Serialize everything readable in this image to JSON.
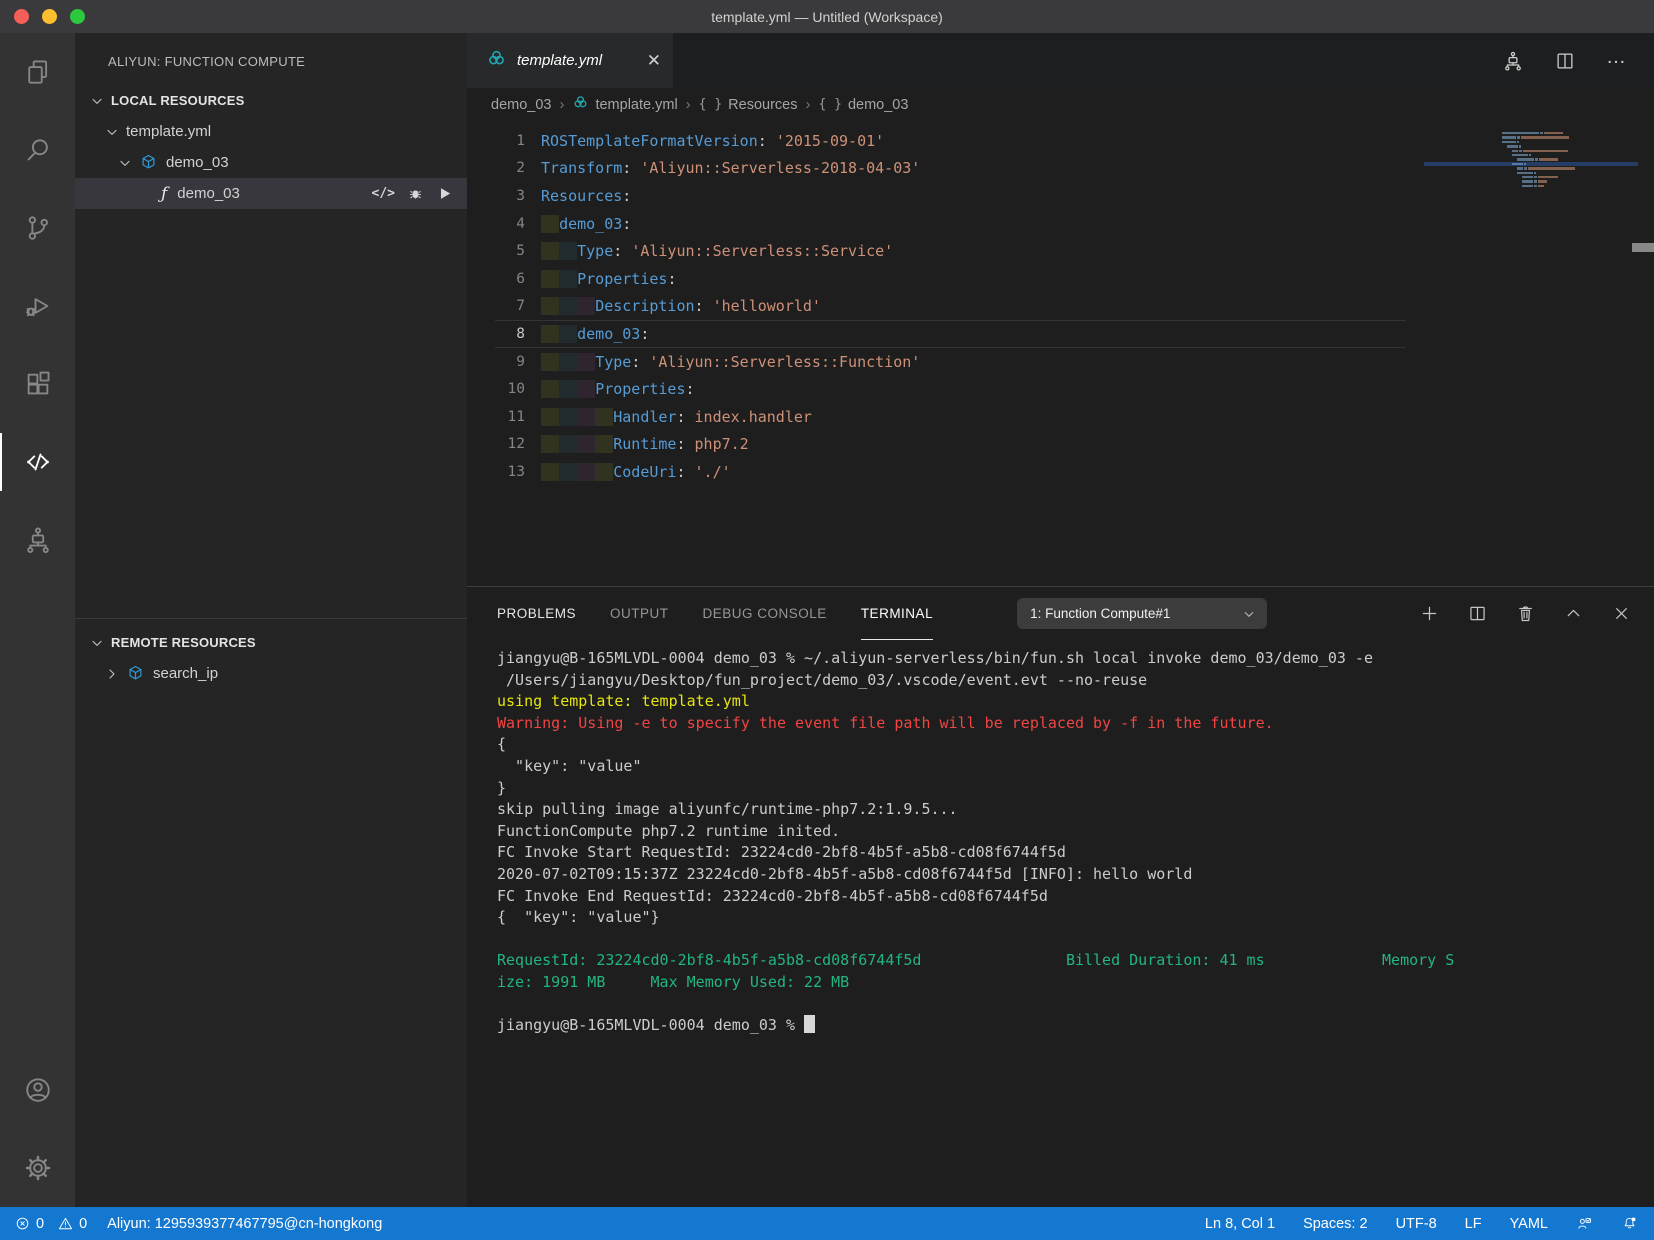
{
  "window": {
    "title": "template.yml — Untitled (Workspace)"
  },
  "colors": {
    "accent": "#1478d1",
    "aliyun_teal": "#1fa8b0",
    "cube_blue": "#2f9ad6",
    "key_blue": "#569cd6",
    "string_orange": "#ce9178",
    "terminal_green": "#23b57f",
    "terminal_yellow": "#e5e510",
    "terminal_red": "#ef4545"
  },
  "sidebar": {
    "title": "ALIYUN: FUNCTION COMPUTE",
    "sections": {
      "local": "LOCAL RESOURCES",
      "remote": "REMOTE RESOURCES"
    },
    "local_tree": {
      "file": "template.yml",
      "service": "demo_03",
      "function": "demo_03"
    },
    "remote_tree": {
      "service": "search_ip"
    }
  },
  "editor": {
    "tab": "template.yml",
    "breadcrumb": [
      "demo_03",
      "template.yml",
      "Resources",
      "demo_03"
    ],
    "code_lines": [
      {
        "n": 1,
        "g": 0,
        "tokens": [
          [
            "k",
            "ROSTemplateFormatVersion"
          ],
          [
            "p",
            ": "
          ],
          [
            "s",
            "'2015-09-01'"
          ]
        ]
      },
      {
        "n": 2,
        "g": 0,
        "tokens": [
          [
            "k",
            "Transform"
          ],
          [
            "p",
            ": "
          ],
          [
            "s",
            "'Aliyun::Serverless-2018-04-03'"
          ]
        ]
      },
      {
        "n": 3,
        "g": 0,
        "tokens": [
          [
            "k",
            "Resources"
          ],
          [
            "p",
            ":"
          ]
        ]
      },
      {
        "n": 4,
        "g": 1,
        "tokens": [
          [
            "k",
            "demo_03"
          ],
          [
            "p",
            ":"
          ]
        ]
      },
      {
        "n": 5,
        "g": 2,
        "tokens": [
          [
            "k",
            "Type"
          ],
          [
            "p",
            ": "
          ],
          [
            "s",
            "'Aliyun::Serverless::Service'"
          ]
        ]
      },
      {
        "n": 6,
        "g": 2,
        "tokens": [
          [
            "k",
            "Properties"
          ],
          [
            "p",
            ":"
          ]
        ]
      },
      {
        "n": 7,
        "g": 3,
        "tokens": [
          [
            "k",
            "Description"
          ],
          [
            "p",
            ": "
          ],
          [
            "s",
            "'helloworld'"
          ]
        ]
      },
      {
        "n": 8,
        "g": 2,
        "current": true,
        "tokens": [
          [
            "k",
            "demo_03"
          ],
          [
            "p",
            ":"
          ]
        ]
      },
      {
        "n": 9,
        "g": 3,
        "tokens": [
          [
            "k",
            "Type"
          ],
          [
            "p",
            ": "
          ],
          [
            "s",
            "'Aliyun::Serverless::Function'"
          ]
        ]
      },
      {
        "n": 10,
        "g": 3,
        "tokens": [
          [
            "k",
            "Properties"
          ],
          [
            "p",
            ":"
          ]
        ]
      },
      {
        "n": 11,
        "g": 4,
        "tokens": [
          [
            "k",
            "Handler"
          ],
          [
            "p",
            ": "
          ],
          [
            "s",
            "index.handler"
          ]
        ]
      },
      {
        "n": 12,
        "g": 4,
        "tokens": [
          [
            "k",
            "Runtime"
          ],
          [
            "p",
            ": "
          ],
          [
            "s",
            "php7.2"
          ]
        ]
      },
      {
        "n": 13,
        "g": 4,
        "tokens": [
          [
            "k",
            "CodeUri"
          ],
          [
            "p",
            ": "
          ],
          [
            "s",
            "'./'"
          ]
        ]
      }
    ]
  },
  "panel": {
    "tabs": [
      "PROBLEMS",
      "OUTPUT",
      "DEBUG CONSOLE",
      "TERMINAL"
    ],
    "active_tab": "TERMINAL",
    "terminal_dropdown": "1: Function Compute#1",
    "terminal_lines": [
      {
        "c": "d",
        "t": "jiangyu@B-165MLVDL-0004 demo_03 % ~/.aliyun-serverless/bin/fun.sh local invoke demo_03/demo_03 -e"
      },
      {
        "c": "d",
        "t": " /Users/jiangyu/Desktop/fun_project/demo_03/.vscode/event.evt --no-reuse"
      },
      {
        "c": "y",
        "t": "using template: template.yml"
      },
      {
        "c": "r",
        "t": "Warning: Using -e to specify the event file path will be replaced by -f in the future."
      },
      {
        "c": "d",
        "t": "{"
      },
      {
        "c": "d",
        "t": "  \"key\": \"value\""
      },
      {
        "c": "d",
        "t": "}"
      },
      {
        "c": "d",
        "t": "skip pulling image aliyunfc/runtime-php7.2:1.9.5..."
      },
      {
        "c": "d",
        "t": "FunctionCompute php7.2 runtime inited."
      },
      {
        "c": "d",
        "t": "FC Invoke Start RequestId: 23224cd0-2bf8-4b5f-a5b8-cd08f6744f5d"
      },
      {
        "c": "d",
        "t": "2020-07-02T09:15:37Z 23224cd0-2bf8-4b5f-a5b8-cd08f6744f5d [INFO]: hello world"
      },
      {
        "c": "d",
        "t": "FC Invoke End RequestId: 23224cd0-2bf8-4b5f-a5b8-cd08f6744f5d"
      },
      {
        "c": "d",
        "t": "{  \"key\": \"value\"}"
      },
      {
        "c": "d",
        "t": ""
      },
      {
        "c": "g",
        "t": "RequestId: 23224cd0-2bf8-4b5f-a5b8-cd08f6744f5d                Billed Duration: 41 ms             Memory S"
      },
      {
        "c": "g",
        "t": "ize: 1991 MB     Max Memory Used: 22 MB"
      },
      {
        "c": "d",
        "t": ""
      },
      {
        "c": "d",
        "t": "jiangyu@B-165MLVDL-0004 demo_03 % ",
        "cursor": true
      }
    ]
  },
  "status_bar": {
    "errors": "0",
    "warnings": "0",
    "account": "Aliyun: 1295939377467795@cn-hongkong",
    "cursor_position": "Ln 8, Col 1",
    "indentation": "Spaces: 2",
    "encoding": "UTF-8",
    "eol": "LF",
    "language": "YAML"
  }
}
